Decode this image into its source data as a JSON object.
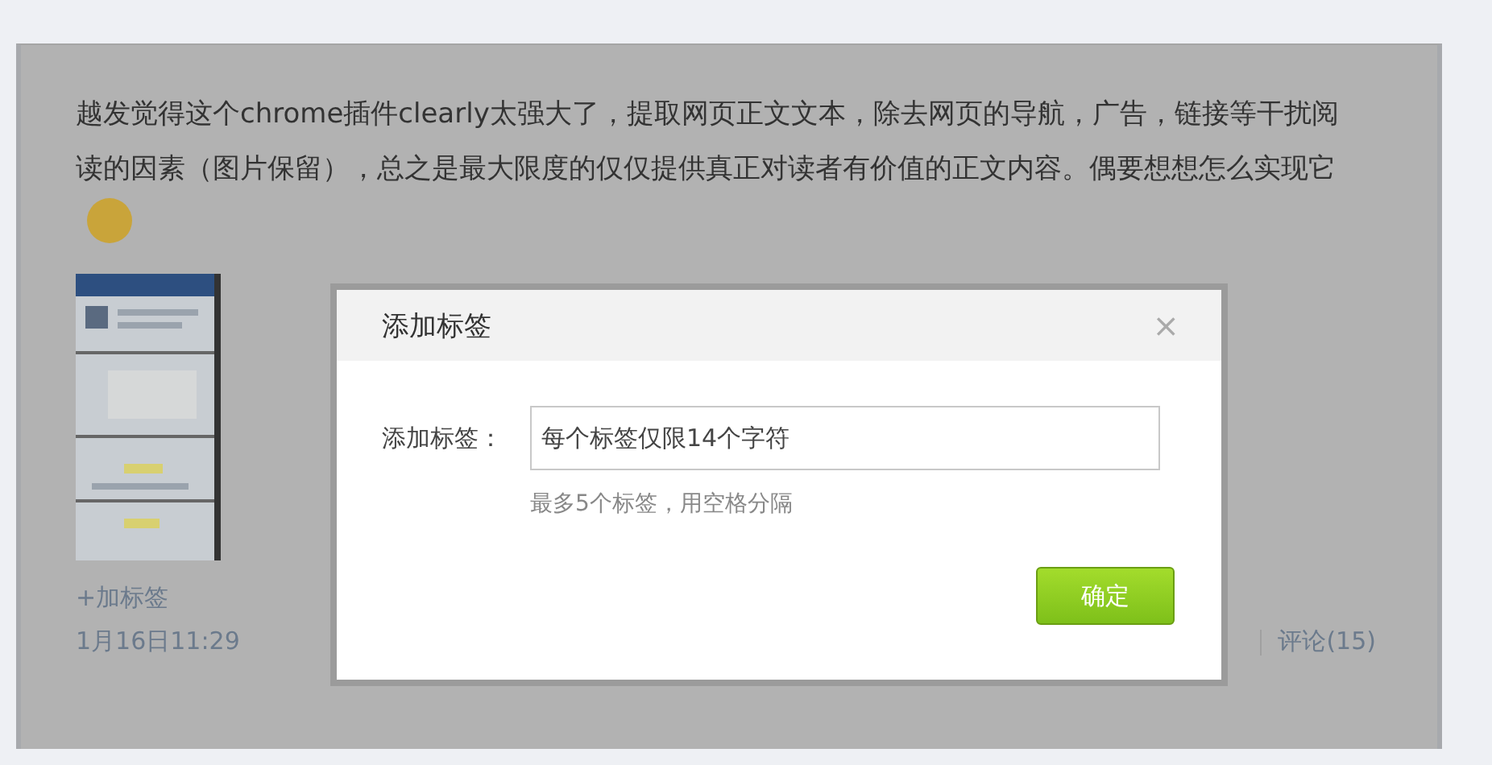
{
  "post": {
    "text": "越发觉得这个chrome插件clearly太强大了，提取网页正文文本，除去网页的导航，广告，链接等干扰阅读的因素（图片保留），总之是最大限度的仅仅提供真正对读者有价值的正文内容。偶要想想怎么实现它",
    "add_tag_link": "+加标签",
    "time": "1月16日11:29",
    "comments": "评论(15)"
  },
  "dialog": {
    "title": "添加标签",
    "close": "×",
    "field_label": "添加标签：",
    "placeholder": "每个标签仅限14个字符",
    "hint": "最多5个标签，用空格分隔",
    "confirm": "确定"
  }
}
